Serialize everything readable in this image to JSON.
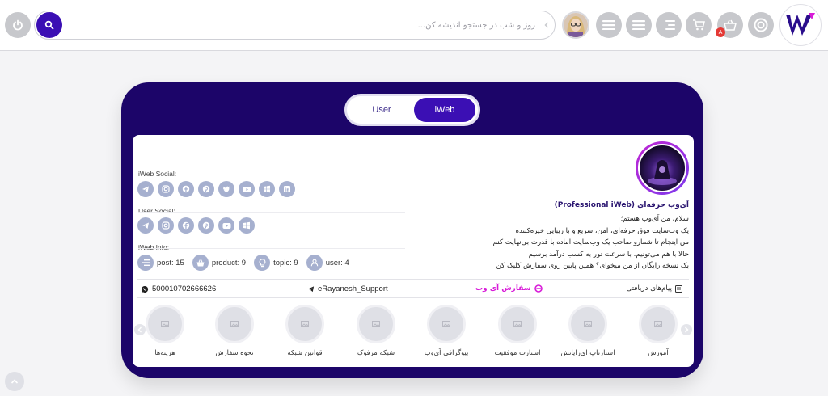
{
  "header": {
    "search": {
      "placeholder": "روز و شب در جستجو اندیشه کن..."
    },
    "cart_badge": "A",
    "icons": [
      "power-icon",
      "search-icon",
      "chevron-left-icon",
      "menu-icon",
      "menu-icon",
      "align-right-icon",
      "cart-icon",
      "basket-icon",
      "target-icon",
      "iweb-logo"
    ]
  },
  "toggle": {
    "user_label": "User",
    "iweb_label": "iWeb"
  },
  "social": {
    "iweb_label": "iWeb Social:",
    "iweb_icons": [
      "telegram-icon",
      "instagram-icon",
      "facebook-icon",
      "pinterest-icon",
      "twitter-icon",
      "youtube-icon",
      "windows-icon",
      "linkedin-icon"
    ],
    "user_label": "User Social:",
    "user_icons": [
      "telegram-icon",
      "instagram-icon",
      "facebook-icon",
      "pinterest-icon",
      "youtube-icon",
      "windows-icon"
    ]
  },
  "info": {
    "label": "iWeb Info:",
    "items": [
      {
        "icon": "list-icon",
        "text": "post: 15"
      },
      {
        "icon": "basket-icon",
        "text": "product: 9"
      },
      {
        "icon": "lightbulb-icon",
        "text": "topic: 9"
      },
      {
        "icon": "user-icon",
        "text": "user: 4"
      }
    ]
  },
  "profile": {
    "title": "آی‌وب حرفه‌ای (Professional iWeb)",
    "bio": [
      "سلام، من آی‌وب هستم؛",
      "یک وب‌سایت فوق حرفه‌ای، امن، سریع و با زیبایی خیره‌کننده",
      "من اینجام تا شمارو صاحب یک وب‌سایت آماده با قدرت بی‌نهایت کنم",
      "حالا با هم می‌تونیم، با سرعت نور به کسب درآمد برسیم",
      "یک نسخه رایگان از من میخوای؟ همین پایین روی سفارش کلیک کن"
    ]
  },
  "contacts": {
    "messages": "پیام‌های دریافتی",
    "order": "سفارش آی وب",
    "telegram": "eRayanesh_Support",
    "phone": "500010702666626"
  },
  "categories": [
    "آموزش",
    "استارتاپ ای‌رایانش",
    "استارت موفقیت",
    "بیوگرافی آی‌وب",
    "شبکه مرفوک",
    "قوانین شبکه",
    "نحوه سفارش",
    "هزینه‌ها"
  ],
  "colors": {
    "brand": "#1c0569",
    "accent": "#3b0fb4",
    "order": "#d81bd8",
    "icon_bg": "#a6b0cf"
  }
}
